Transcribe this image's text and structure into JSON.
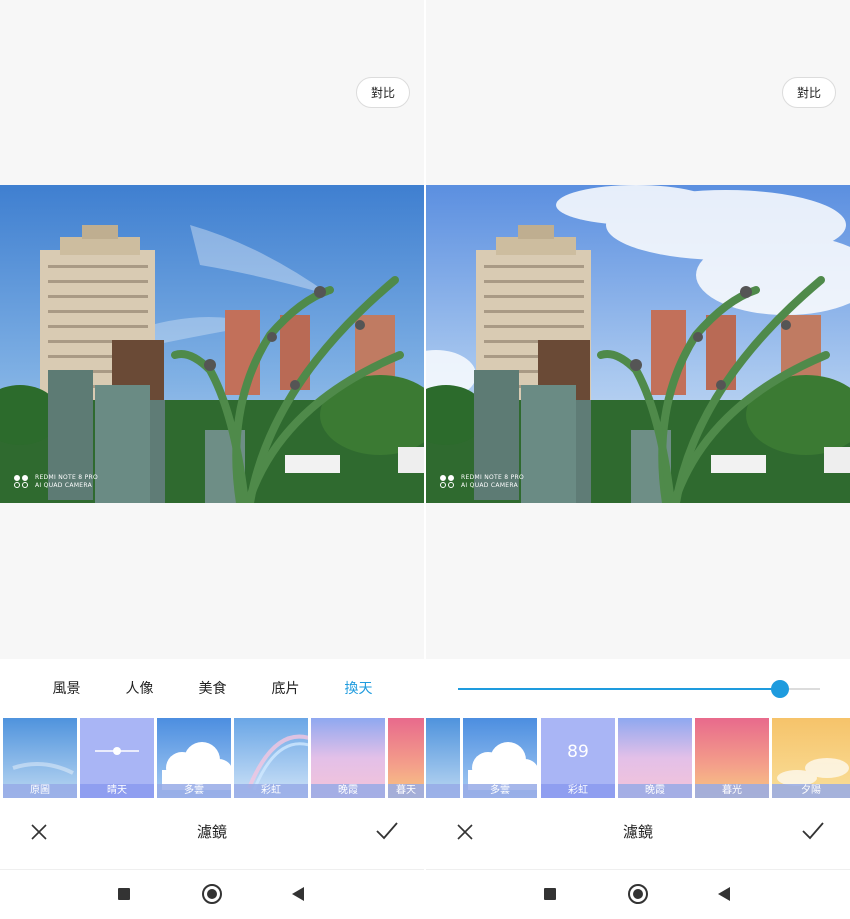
{
  "left": {
    "compare_label": "對比",
    "watermark": {
      "line1": "REDMI NOTE 8 PRO",
      "line2": "AI QUAD CAMERA"
    },
    "tabs": [
      {
        "label": "風景",
        "active": false
      },
      {
        "label": "人像",
        "active": false
      },
      {
        "label": "美食",
        "active": false
      },
      {
        "label": "底片",
        "active": false
      },
      {
        "label": "換天",
        "active": true
      }
    ],
    "filters": [
      {
        "name": "原圖",
        "selected": false,
        "sky": "clear"
      },
      {
        "name": "晴天",
        "selected": true,
        "sky": "selected"
      },
      {
        "name": "多雲",
        "selected": false,
        "sky": "cloudy"
      },
      {
        "name": "彩虹",
        "selected": false,
        "sky": "rainbow"
      },
      {
        "name": "晚霞",
        "selected": false,
        "sky": "pastel"
      },
      {
        "name": "暮天",
        "selected": false,
        "sky": "dusk"
      }
    ],
    "title": "濾鏡"
  },
  "right": {
    "compare_label": "對比",
    "watermark": {
      "line1": "REDMI NOTE 8 PRO",
      "line2": "AI QUAD CAMERA"
    },
    "slider": {
      "value_fraction": 0.89
    },
    "filters": [
      {
        "name": "",
        "selected": false,
        "sky": "clear"
      },
      {
        "name": "多雲",
        "selected": false,
        "sky": "cloudy"
      },
      {
        "name": "彩虹",
        "selected": true,
        "value": "89",
        "sky": "selected"
      },
      {
        "name": "晚霞",
        "selected": false,
        "sky": "pastel"
      },
      {
        "name": "暮光",
        "selected": false,
        "sky": "dusk"
      },
      {
        "name": "夕陽",
        "selected": false,
        "sky": "sunset"
      }
    ],
    "title": "濾鏡"
  },
  "colors": {
    "accent": "#1e9bde",
    "selected_tile": "#a9b5f5"
  },
  "icons": {
    "close": "close-icon",
    "confirm": "check-icon",
    "nav_recent": "square-icon",
    "nav_home": "home-circle-icon",
    "nav_back": "back-triangle-icon"
  }
}
